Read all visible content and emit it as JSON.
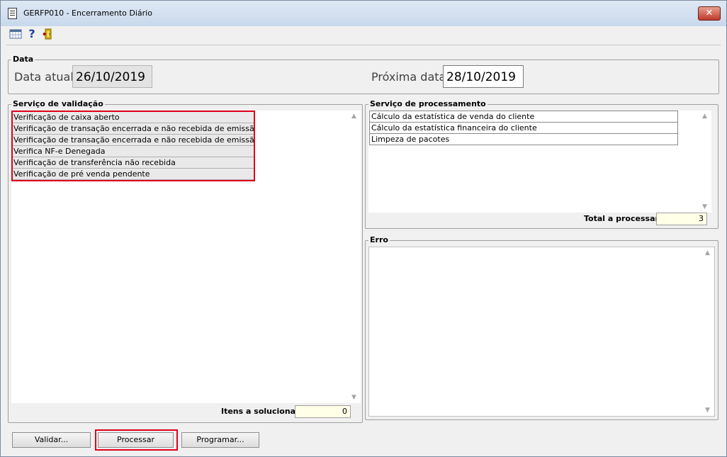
{
  "window": {
    "title": "GERFP010 - Encerramento Diário",
    "close_label": "✕"
  },
  "toolbar": {
    "help_glyph": "?"
  },
  "data_group": {
    "legend": "Data",
    "current_label": "Data atual",
    "current_value": "26/10/2019",
    "next_label": "Próxima data",
    "next_value": "28/10/2019"
  },
  "validation": {
    "legend": "Serviço de validação",
    "items": [
      "Verificação de caixa aberto",
      "Verificação de transação encerrada e não recebida de emissão própri",
      "Verificação de transação encerrada e não recebida de emissão própri",
      "Verifica NF-e Denegada",
      "Verificação de transferência não recebida",
      "Verificação de pré venda pendente"
    ],
    "summary_label": "Itens a solucionar",
    "summary_value": "0"
  },
  "processing": {
    "legend": "Serviço de processamento",
    "items": [
      "Cálculo da estatística de venda do cliente",
      "Cálculo da estatística financeira do cliente",
      "Limpeza de pacotes"
    ],
    "summary_label": "Total a processar",
    "summary_value": "3"
  },
  "error": {
    "legend": "Erro"
  },
  "buttons": {
    "validar": "Validar...",
    "processar": "Processar",
    "programar": "Programar..."
  },
  "scroll": {
    "up": "▲",
    "down": "▼"
  },
  "colors": {
    "highlight": "#e0001b",
    "summary_field": "#ffffe8",
    "readonly_field": "#e3e3e3"
  }
}
